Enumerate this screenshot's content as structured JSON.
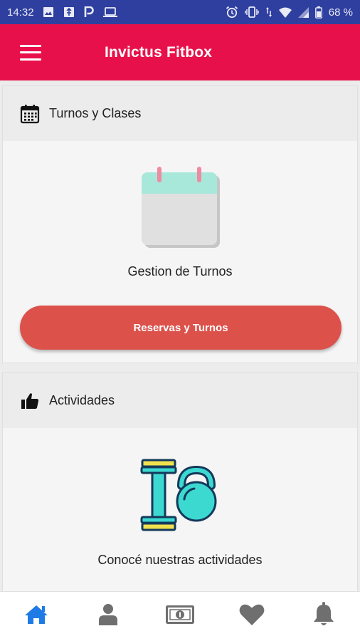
{
  "status_bar": {
    "time": "14:32",
    "battery": "68 %"
  },
  "app_bar": {
    "title": "Invictus Fitbox",
    "menu_icon": "hamburger-menu-icon"
  },
  "cards": [
    {
      "header_icon": "calendar-icon",
      "title": "Turnos y Clases",
      "illustration": "calendar-illustration",
      "caption": "Gestion de Turnos",
      "button_label": "Reservas y Turnos"
    },
    {
      "header_icon": "thumbs-up-icon",
      "title": "Actividades",
      "illustration": "dumbbell-kettlebell-illustration",
      "caption": "Conocé nuestras actividades"
    }
  ],
  "bottom_nav": [
    {
      "icon": "home-icon",
      "active": true
    },
    {
      "icon": "user-icon",
      "active": false
    },
    {
      "icon": "money-icon",
      "active": false
    },
    {
      "icon": "heart-icon",
      "active": false
    },
    {
      "icon": "bell-icon",
      "active": false
    }
  ],
  "colors": {
    "status_bar": "#2f3f9f",
    "app_bar": "#e8104a",
    "button": "#dc524b",
    "nav_active": "#1e7be6",
    "nav_inactive": "#6f6f6f"
  }
}
